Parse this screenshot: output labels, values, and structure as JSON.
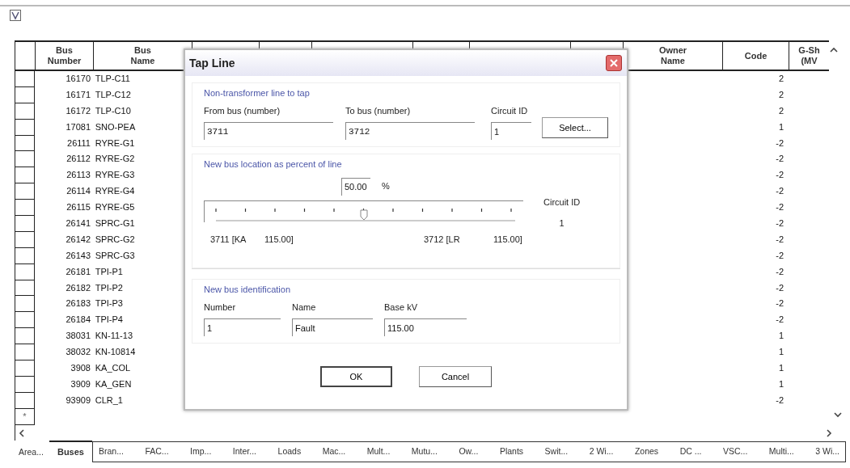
{
  "table": {
    "columns": [
      {
        "kind": "blank"
      },
      {
        "lines": [
          "Bus",
          "Number"
        ]
      },
      {
        "lines": [
          "Bus",
          "Name"
        ]
      },
      {
        "kind": "blank"
      },
      {
        "kind": "blank"
      },
      {
        "kind": "blank"
      },
      {
        "kind": "blank"
      },
      {
        "kind": "blank"
      },
      {
        "kind": "blank"
      },
      {
        "lines": [
          "Owner",
          "Name"
        ]
      },
      {
        "lines": [
          "Code"
        ]
      },
      {
        "lines": [
          "G-Sh",
          "(MV"
        ]
      }
    ],
    "rows": [
      {
        "number": "16170",
        "name": "TLP-C11",
        "code": "2"
      },
      {
        "number": "16171",
        "name": "TLP-C12",
        "code": "2"
      },
      {
        "number": "16172",
        "name": "TLP-C10",
        "code": "2"
      },
      {
        "number": "17081",
        "name": "SNO-PEA",
        "code": "1"
      },
      {
        "number": "26111",
        "name": "RYRE-G1",
        "code": "-2"
      },
      {
        "number": "26112",
        "name": "RYRE-G2",
        "code": "-2"
      },
      {
        "number": "26113",
        "name": "RYRE-G3",
        "code": "-2"
      },
      {
        "number": "26114",
        "name": "RYRE-G4",
        "code": "-2"
      },
      {
        "number": "26115",
        "name": "RYRE-G5",
        "code": "-2"
      },
      {
        "number": "26141",
        "name": "SPRC-G1",
        "code": "-2"
      },
      {
        "number": "26142",
        "name": "SPRC-G2",
        "code": "-2"
      },
      {
        "number": "26143",
        "name": "SPRC-G3",
        "code": "-2"
      },
      {
        "number": "26181",
        "name": "TPI-P1",
        "code": "-2"
      },
      {
        "number": "26182",
        "name": "TPI-P2",
        "code": "-2"
      },
      {
        "number": "26183",
        "name": "TPI-P3",
        "code": "-2"
      },
      {
        "number": "26184",
        "name": "TPI-P4",
        "code": "-2"
      },
      {
        "number": "38031",
        "name": "KN-11-13",
        "code": "1"
      },
      {
        "number": "38032",
        "name": "KN-10814",
        "code": "1"
      },
      {
        "number": "3908",
        "name": "KA_COL",
        "code": "1"
      },
      {
        "number": "3909",
        "name": "KA_GEN",
        "code": "1"
      },
      {
        "number": "93909",
        "name": "CLR_1",
        "code": "-2"
      }
    ],
    "new_row_mark": "*"
  },
  "dialog": {
    "title": "Tap Line",
    "line_group": {
      "title": "Non-transformer line to tap",
      "from_label": "From bus (number)",
      "from_value": "3711",
      "to_label": "To bus (number)",
      "to_value": "3712",
      "circuit_label": "Circuit ID",
      "circuit_value": "1",
      "select_button": "Select..."
    },
    "location_group": {
      "title": "New bus location as percent of line",
      "percent_value": "50.00",
      "percent_unit": "%",
      "level": 0.5,
      "from_end": "3711 [KA",
      "from_kv": "115.00]",
      "to_end": "3712 [LR",
      "to_kv": "115.00]",
      "circuit_label": "Circuit ID",
      "circuit_value": "1"
    },
    "id_group": {
      "title": "New bus identification",
      "number_label": "Number",
      "number_value": "1",
      "name_label": "Name",
      "name_value": "Fault",
      "kv_label": "Base kV",
      "kv_value": "115.00"
    },
    "ok_button": "OK",
    "cancel_button": "Cancel"
  },
  "sheet_tabs": [
    {
      "label": "Area...",
      "selected": false
    },
    {
      "label": "Buses",
      "selected": true
    },
    {
      "label": "Bran...",
      "selected": false
    },
    {
      "label": "FAC...",
      "selected": false
    },
    {
      "label": "Imp...",
      "selected": false
    },
    {
      "label": "Inter...",
      "selected": false
    },
    {
      "label": "Loads",
      "selected": false
    },
    {
      "label": "Mac...",
      "selected": false
    },
    {
      "label": "Mult...",
      "selected": false
    },
    {
      "label": "Mutu...",
      "selected": false
    },
    {
      "label": "Ow...",
      "selected": false
    },
    {
      "label": "Plants",
      "selected": false
    },
    {
      "label": "Swit...",
      "selected": false
    },
    {
      "label": "2 Wi...",
      "selected": false
    },
    {
      "label": "Zones",
      "selected": false
    },
    {
      "label": "DC ...",
      "selected": false
    },
    {
      "label": "VSC...",
      "selected": false
    },
    {
      "label": "Multi...",
      "selected": false
    },
    {
      "label": "3 Wi...",
      "selected": false
    }
  ]
}
